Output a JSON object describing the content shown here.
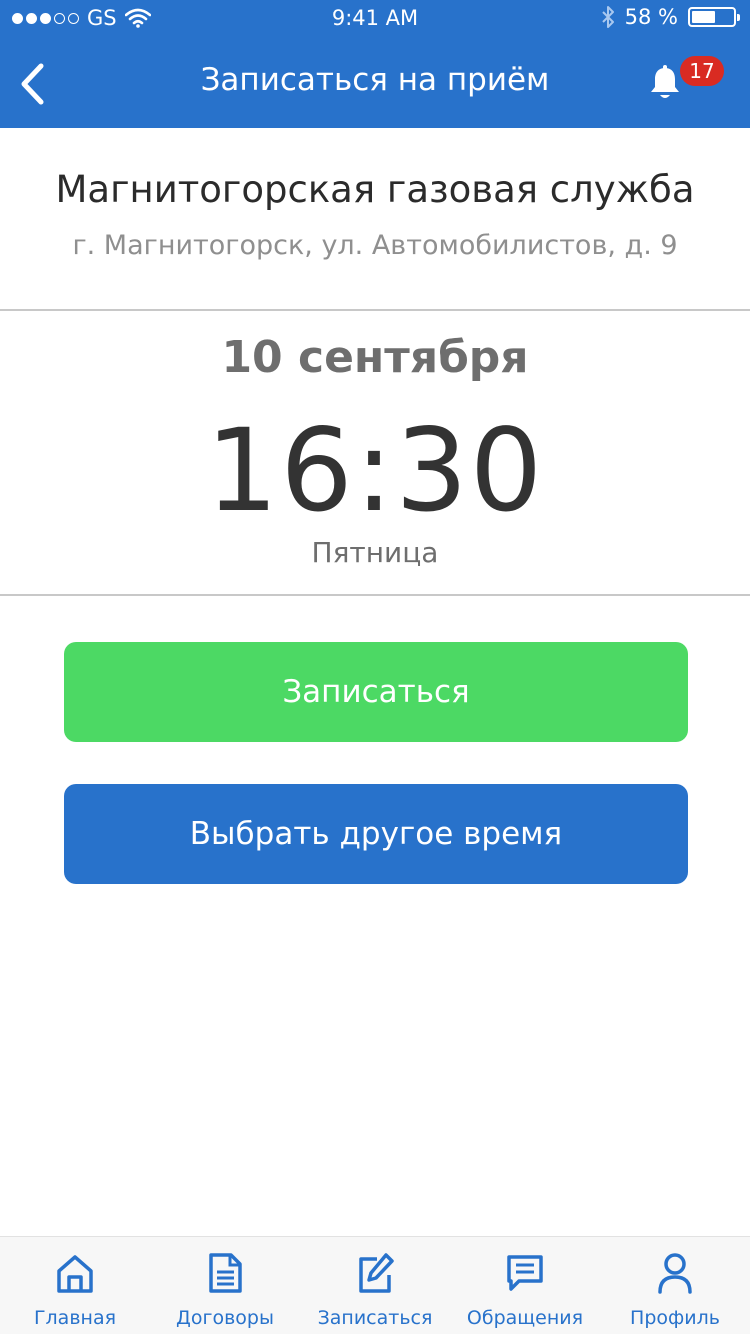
{
  "status_bar": {
    "carrier": "GS",
    "time": "9:41 AM",
    "battery_text": "58 %",
    "battery_level": 0.58
  },
  "nav": {
    "title": "Записаться на приём",
    "back_icon": "chevron-left-icon",
    "notifications_icon": "bell-icon",
    "notification_count": "17"
  },
  "organization": {
    "name": "Магнитогорская газовая служба",
    "address": "г. Магнитогорск, ул. Автомобилистов, д. 9"
  },
  "appointment": {
    "date": "10 сентября",
    "time": "16:30",
    "weekday": "Пятница"
  },
  "actions": {
    "confirm_label": "Записаться",
    "reschedule_label": "Выбрать другое время"
  },
  "tabs": [
    {
      "label": "Главная",
      "icon": "home-icon"
    },
    {
      "label": "Договоры",
      "icon": "document-icon"
    },
    {
      "label": "Записаться",
      "icon": "edit-icon"
    },
    {
      "label": "Обращения",
      "icon": "message-icon"
    },
    {
      "label": "Профиль",
      "icon": "user-icon"
    }
  ],
  "colors": {
    "primary": "#2872cb",
    "success": "#4cd964",
    "badge": "#d92b22"
  }
}
